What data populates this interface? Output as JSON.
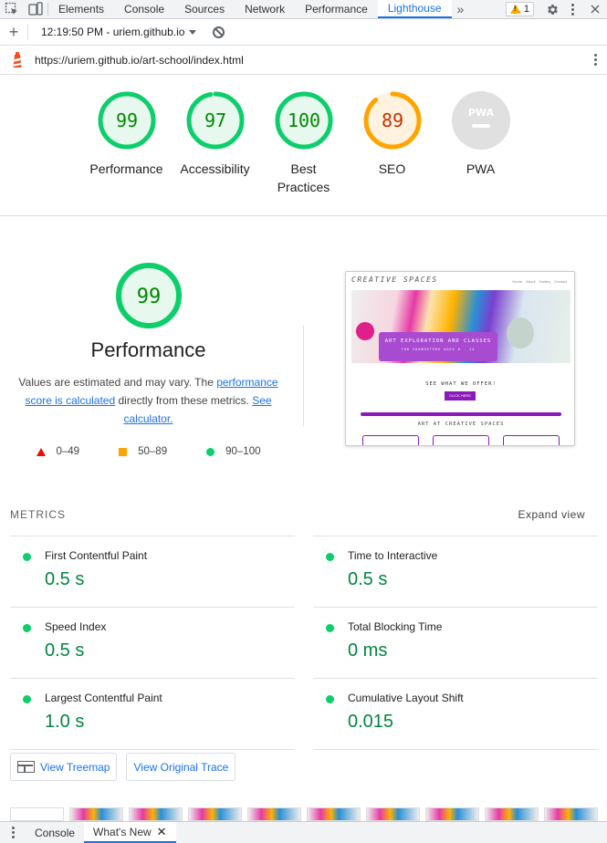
{
  "devtools": {
    "tabs": [
      {
        "label": "Elements"
      },
      {
        "label": "Console"
      },
      {
        "label": "Sources"
      },
      {
        "label": "Network"
      },
      {
        "label": "Performance"
      },
      {
        "label": "Lighthouse",
        "active": true
      }
    ],
    "more_tabs": "»",
    "warning_count": "1"
  },
  "toolbar": {
    "add": "+",
    "report_select": "12:19:50 PM - uriem.github.io"
  },
  "url": "https://uriem.github.io/art-school/index.html",
  "gauges": [
    {
      "score": "99",
      "label": "Performance",
      "color": "#0cce6b",
      "fraction": 0.99
    },
    {
      "score": "97",
      "label": "Accessibility",
      "color": "#0cce6b",
      "fraction": 0.97
    },
    {
      "score": "100",
      "label": "Best Practices",
      "color": "#0cce6b",
      "fraction": 1.0
    },
    {
      "score": "89",
      "label": "SEO",
      "color": "#ffa400",
      "fraction": 0.89
    },
    {
      "score": "",
      "label": "PWA",
      "color": "#cccccc",
      "fraction": 0,
      "badge": "PWA"
    }
  ],
  "performance": {
    "score": "99",
    "title": "Performance",
    "desc_pre": "Values are estimated and may vary. The ",
    "desc_link1": "performance score is calculated",
    "desc_mid": " directly from these metrics. ",
    "desc_link2": "See calculator.",
    "legend": [
      {
        "range": "0–49",
        "shape": "triangle",
        "color": "#eb0f00"
      },
      {
        "range": "50–89",
        "shape": "square",
        "color": "#ffa400"
      },
      {
        "range": "90–100",
        "shape": "circle",
        "color": "#0cce6b"
      }
    ]
  },
  "screenshot": {
    "site_title": "CREATIVE SPACES",
    "nav": [
      "Home",
      "About",
      "Gallery",
      "Contact"
    ],
    "banner_title": "ART EXPLORATION AND CLASSES",
    "banner_sub": "FOR YOUNGSTERS AGES 6 - 14",
    "offer": "SEE WHAT WE OFFER!",
    "button": "CLICK HERE",
    "section": "ART AT CREATIVE SPACES"
  },
  "metrics": {
    "label": "METRICS",
    "expand": "Expand view",
    "items": [
      {
        "title": "First Contentful Paint",
        "value": "0.5 s"
      },
      {
        "title": "Time to Interactive",
        "value": "0.5 s"
      },
      {
        "title": "Speed Index",
        "value": "0.5 s"
      },
      {
        "title": "Total Blocking Time",
        "value": "0 ms"
      },
      {
        "title": "Largest Contentful Paint",
        "value": "1.0 s"
      },
      {
        "title": "Cumulative Layout Shift",
        "value": "0.015"
      }
    ]
  },
  "buttons": {
    "treemap": "View Treemap",
    "trace": "View Original Trace"
  },
  "drawer": {
    "tabs": [
      {
        "label": "Console"
      },
      {
        "label": "What's New",
        "active": true
      }
    ]
  }
}
